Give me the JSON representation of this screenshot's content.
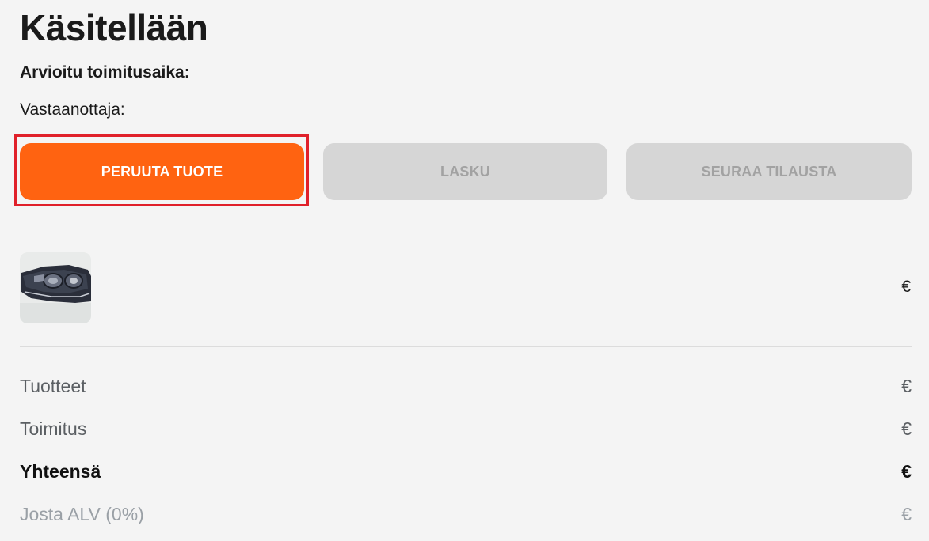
{
  "order": {
    "status_title": "Käsitellään",
    "delivery_label": "Arvioitu toimitusaika:",
    "recipient_label": "Vastaanottaja:"
  },
  "actions": {
    "cancel_label": "PERUUTA TUOTE",
    "invoice_label": "LASKU",
    "track_label": "SEURAA TILAUSTA"
  },
  "product": {
    "price": "€"
  },
  "summary": {
    "products_label": "Tuotteet",
    "products_value": "€",
    "shipping_label": "Toimitus",
    "shipping_value": "€",
    "total_label": "Yhteensä",
    "total_value": "€",
    "vat_label": "Josta ALV (0%)",
    "vat_value": "€"
  },
  "colors": {
    "accent": "#ff6311",
    "disabled_button": "#d6d6d6",
    "highlight": "#e0202a",
    "background": "#f4f4f4"
  }
}
